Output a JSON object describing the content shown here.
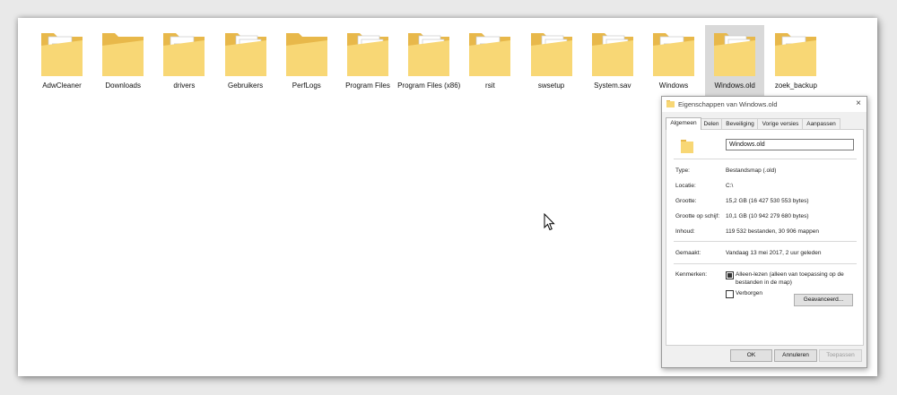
{
  "folders": [
    {
      "label": "AdwCleaner",
      "variant": "doc"
    },
    {
      "label": "Downloads",
      "variant": "plain"
    },
    {
      "label": "drivers",
      "variant": "doc"
    },
    {
      "label": "Gebruikers",
      "variant": "stack"
    },
    {
      "label": "PerfLogs",
      "variant": "plain"
    },
    {
      "label": "Program Files",
      "variant": "stack"
    },
    {
      "label": "Program Files (x86)",
      "variant": "stack"
    },
    {
      "label": "rsit",
      "variant": "doc"
    },
    {
      "label": "swsetup",
      "variant": "stack"
    },
    {
      "label": "System.sav",
      "variant": "stack"
    },
    {
      "label": "Windows",
      "variant": "doc"
    },
    {
      "label": "Windows.old",
      "variant": "stack",
      "selected": true
    },
    {
      "label": "zoek_backup",
      "variant": "doc"
    }
  ],
  "dialog": {
    "title": "Eigenschappen van Windows.old",
    "close_icon": "×",
    "tabs": [
      "Algemeen",
      "Delen",
      "Beveiliging",
      "Vorige versies",
      "Aanpassen"
    ],
    "active_tab": "Algemeen",
    "name_value": "Windows.old",
    "props": {
      "type_label": "Type:",
      "type_value": "Bestandsmap (.old)",
      "location_label": "Locatie:",
      "location_value": "C:\\",
      "size_label": "Grootte:",
      "size_value": "15,2 GB (16 427 530 553 bytes)",
      "disk_label": "Grootte op schijf:",
      "disk_value": "10,1 GB (10 942 279 680 bytes)",
      "contents_label": "Inhoud:",
      "contents_value": "119 532 bestanden, 30 906 mappen",
      "created_label": "Gemaakt:",
      "created_value": "Vandaag 13 mei 2017, 2 uur geleden",
      "attributes_label": "Kenmerken:"
    },
    "attributes": {
      "readonly_label": "Alleen-lezen (alleen van toepassing op de bestanden in de map)",
      "readonly_checked": true,
      "hidden_label": "Verborgen",
      "hidden_checked": false,
      "advanced_label": "Geavanceerd..."
    },
    "buttons": {
      "ok": "OK",
      "cancel": "Annuleren",
      "apply": "Toepassen"
    }
  },
  "colors": {
    "folder_body": "#f8d775",
    "folder_back": "#e8b84a",
    "selection": "#d9d9d9"
  }
}
